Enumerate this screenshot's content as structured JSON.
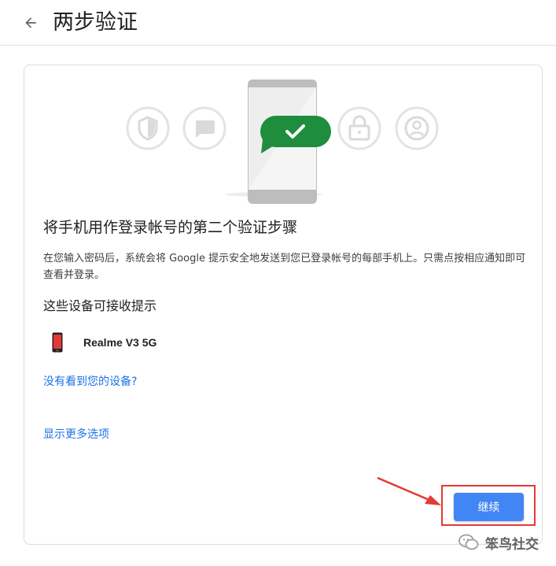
{
  "header": {
    "title": "两步验证",
    "back_icon": "arrow-left-icon"
  },
  "card": {
    "heading": "将手机用作登录帐号的第二个验证步骤",
    "description": "在您输入密码后，系统会将 Google 提示安全地发送到您已登录帐号的每部手机上。只需点按相应通知即可查看并登录。",
    "devices_heading": "这些设备可接收提示",
    "devices": [
      {
        "name": "Realme V3 5G",
        "icon": "smartphone-icon"
      }
    ],
    "no_device_link": "没有看到您的设备?",
    "more_options_link": "显示更多选项",
    "continue_button": "继续"
  },
  "illustration": {
    "icons": [
      "shield-icon",
      "chat-bubble-icon",
      "phone-checkmark-icon",
      "lock-icon",
      "account-icon"
    ],
    "accent_color": "#1e8e3e"
  },
  "annotation": {
    "highlight_color": "#e53935"
  },
  "watermark": {
    "text": "笨鸟社交"
  },
  "colors": {
    "link": "#1a73e8",
    "button": "#4285f4"
  }
}
